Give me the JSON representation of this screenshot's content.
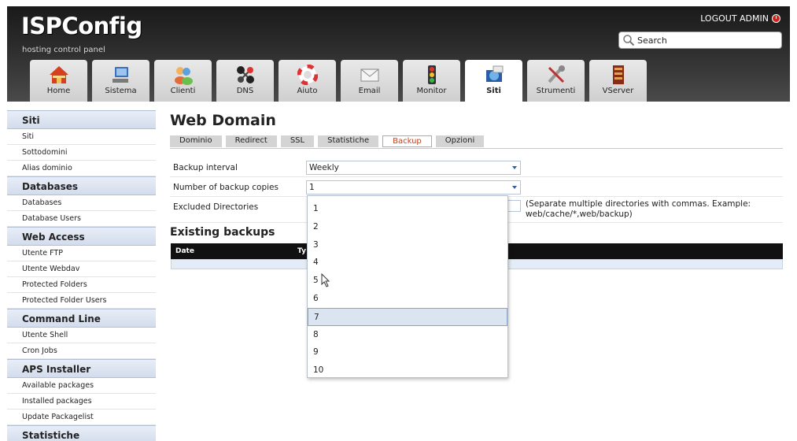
{
  "header": {
    "logo": "ISPConfig",
    "tagline": "hosting control panel",
    "logout_label": "LOGOUT ADMIN",
    "search_placeholder": "Search",
    "tabs": [
      {
        "label": "Home",
        "icon": "home-icon"
      },
      {
        "label": "Sistema",
        "icon": "computer-icon"
      },
      {
        "label": "Clienti",
        "icon": "users-icon"
      },
      {
        "label": "DNS",
        "icon": "network-icon"
      },
      {
        "label": "Aiuto",
        "icon": "lifebuoy-icon"
      },
      {
        "label": "Email",
        "icon": "envelope-icon"
      },
      {
        "label": "Monitor",
        "icon": "traffic-light-icon"
      },
      {
        "label": "Siti",
        "icon": "globe-icon",
        "active": true
      },
      {
        "label": "Strumenti",
        "icon": "tools-icon"
      },
      {
        "label": "VServer",
        "icon": "server-icon"
      }
    ]
  },
  "sidebar": {
    "sections": [
      {
        "title": "Siti",
        "items": [
          "Siti",
          "Sottodomini",
          "Alias dominio"
        ]
      },
      {
        "title": "Databases",
        "items": [
          "Databases",
          "Database Users"
        ]
      },
      {
        "title": "Web Access",
        "items": [
          "Utente FTP",
          "Utente Webdav",
          "Protected Folders",
          "Protected Folder Users"
        ]
      },
      {
        "title": "Command Line",
        "items": [
          "Utente Shell",
          "Cron Jobs"
        ]
      },
      {
        "title": "APS Installer",
        "items": [
          "Available packages",
          "Installed packages",
          "Update Packagelist"
        ]
      },
      {
        "title": "Statistiche",
        "items": []
      }
    ]
  },
  "main": {
    "title": "Web Domain",
    "subtabs": [
      "Dominio",
      "Redirect",
      "SSL",
      "Statistiche",
      "Backup",
      "Opzioni"
    ],
    "active_subtab": "Backup",
    "form": {
      "backup_interval_label": "Backup interval",
      "backup_interval_value": "Weekly",
      "backup_copies_label": "Number of backup copies",
      "backup_copies_value": "1",
      "excluded_dirs_label": "Excluded Directories",
      "excluded_dirs_value": "",
      "excluded_dirs_hint": "(Separate multiple directories with commas. Example: web/cache/*,web/backup)"
    },
    "existing_backups_title": "Existing backups",
    "table_headers": [
      "Date",
      "Ty"
    ]
  },
  "dropdown": {
    "options": [
      "1",
      "2",
      "3",
      "4",
      "5",
      "6",
      "7",
      "8",
      "9",
      "10"
    ],
    "highlighted": "7"
  },
  "colors": {
    "header_bg": "#2b2b2b",
    "active_subtab_text": "#c0401c",
    "sidebar_head_bg": "#d3dced",
    "logout_icon": "#d0211c"
  }
}
